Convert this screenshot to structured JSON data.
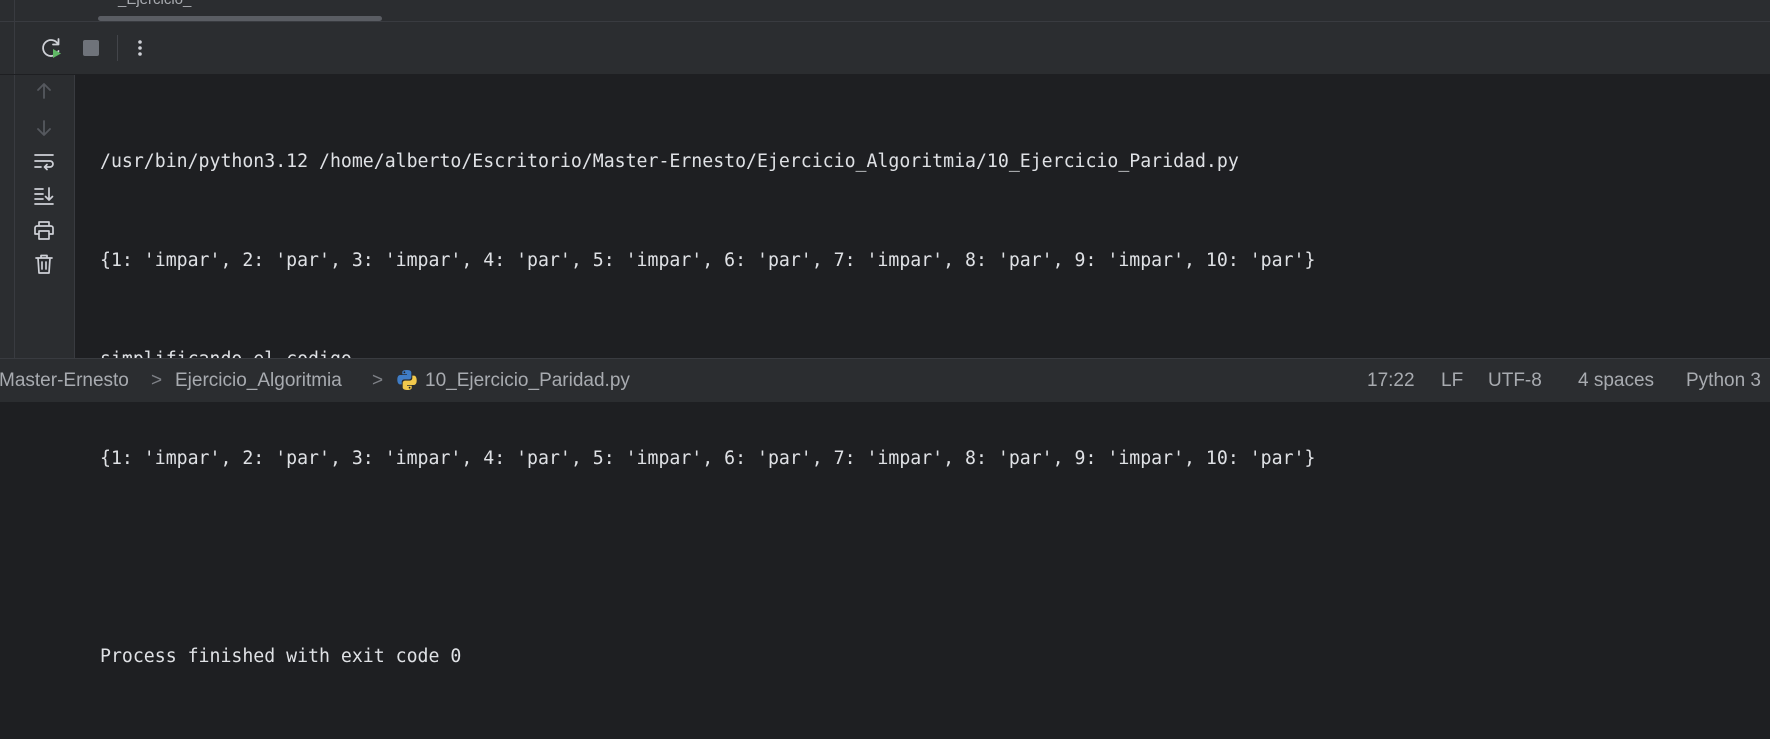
{
  "top_strip": {
    "tab_fragment": "_Ejercicio_"
  },
  "toolbar": {
    "rerun_icon": "rerun-icon",
    "stop_icon": "stop-icon",
    "more_icon": "more-vertical-icon"
  },
  "sidebar": {
    "icons": [
      "arrow-up-icon",
      "arrow-down-icon",
      "soft-wrap-icon",
      "scroll-to-end-icon",
      "print-icon",
      "trash-icon"
    ]
  },
  "console": {
    "lines": [
      "/usr/bin/python3.12 /home/alberto/Escritorio/Master-Ernesto/Ejercicio_Algoritmia/10_Ejercicio_Paridad.py",
      "{1: 'impar', 2: 'par', 3: 'impar', 4: 'par', 5: 'impar', 6: 'par', 7: 'impar', 8: 'par', 9: 'impar', 10: 'par'}",
      "simplificando el codigo",
      "{1: 'impar', 2: 'par', 3: 'impar', 4: 'par', 5: 'impar', 6: 'par', 7: 'impar', 8: 'par', 9: 'impar', 10: 'par'}",
      "",
      "Process finished with exit code 0"
    ]
  },
  "statusbar": {
    "breadcrumb": [
      "Master-Ernesto",
      "Ejercicio_Algoritmia",
      "10_Ejercicio_Paridad.py"
    ],
    "breadcrumb_sep": ">",
    "file_icon": "python-file-icon",
    "position": "17:22",
    "line_separator": "LF",
    "encoding": "UTF-8",
    "indent": "4 spaces",
    "interpreter": "Python 3"
  }
}
